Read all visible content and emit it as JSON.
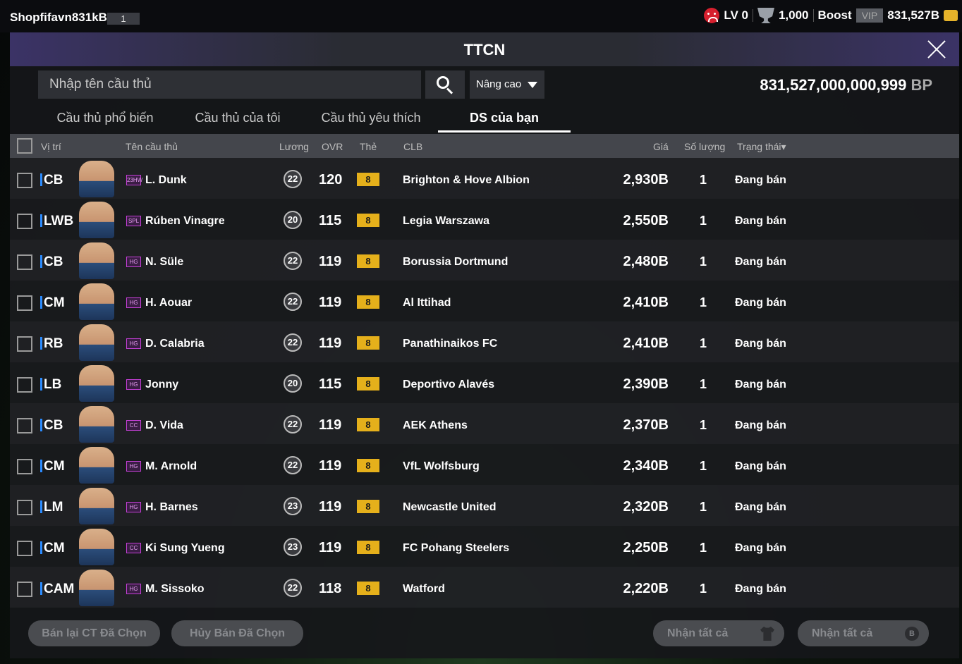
{
  "topbar": {
    "username": "Shopfifavn831kBP",
    "user_level": "1",
    "level": "LV 0",
    "cup_value": "1,000",
    "boost_label": "Boost",
    "vip_label": "VIP",
    "coins": "831,527B"
  },
  "panel": {
    "title": "TTCN",
    "search_placeholder": "Nhập tên cầu thủ",
    "advanced_label": "Nâng cao",
    "balance_value": "831,527,000,000,999",
    "balance_unit": "BP"
  },
  "tabs": [
    "Cầu thủ phổ biến",
    "Cầu thủ của tôi",
    "Cầu thủ yêu thích",
    "DS của bạn"
  ],
  "active_tab": 3,
  "columns": {
    "position": "Vị trí",
    "name": "Tên cầu thủ",
    "salary": "Lương",
    "ovr": "OVR",
    "card": "Thẻ",
    "club": "CLB",
    "price": "Giá",
    "qty": "Số lượng",
    "status": "Trạng thái▾"
  },
  "players": [
    {
      "pos": "CB",
      "season": "23HW",
      "name": "L. Dunk",
      "salary": "22",
      "ovr": "120",
      "card": "8",
      "club": "Brighton & Hove Albion",
      "price": "2,930B",
      "qty": "1",
      "status": "Đang bán"
    },
    {
      "pos": "LWB",
      "season": "SPL",
      "name": "Rúben Vinagre",
      "salary": "20",
      "ovr": "115",
      "card": "8",
      "club": "Legia Warszawa",
      "price": "2,550B",
      "qty": "1",
      "status": "Đang bán"
    },
    {
      "pos": "CB",
      "season": "HG",
      "name": "N. Süle",
      "salary": "22",
      "ovr": "119",
      "card": "8",
      "club": "Borussia Dortmund",
      "price": "2,480B",
      "qty": "1",
      "status": "Đang bán"
    },
    {
      "pos": "CM",
      "season": "HG",
      "name": "H. Aouar",
      "salary": "22",
      "ovr": "119",
      "card": "8",
      "club": "Al Ittihad",
      "price": "2,410B",
      "qty": "1",
      "status": "Đang bán"
    },
    {
      "pos": "RB",
      "season": "HG",
      "name": "D. Calabria",
      "salary": "22",
      "ovr": "119",
      "card": "8",
      "club": "Panathinaikos FC",
      "price": "2,410B",
      "qty": "1",
      "status": "Đang bán"
    },
    {
      "pos": "LB",
      "season": "HG",
      "name": "Jonny",
      "salary": "20",
      "ovr": "115",
      "card": "8",
      "club": "Deportivo Alavés",
      "price": "2,390B",
      "qty": "1",
      "status": "Đang bán"
    },
    {
      "pos": "CB",
      "season": "CC",
      "name": "D. Vida",
      "salary": "22",
      "ovr": "119",
      "card": "8",
      "club": "AEK Athens",
      "price": "2,370B",
      "qty": "1",
      "status": "Đang bán"
    },
    {
      "pos": "CM",
      "season": "HG",
      "name": "M. Arnold",
      "salary": "22",
      "ovr": "119",
      "card": "8",
      "club": "VfL Wolfsburg",
      "price": "2,340B",
      "qty": "1",
      "status": "Đang bán"
    },
    {
      "pos": "LM",
      "season": "HG",
      "name": "H. Barnes",
      "salary": "23",
      "ovr": "119",
      "card": "8",
      "club": "Newcastle United",
      "price": "2,320B",
      "qty": "1",
      "status": "Đang bán"
    },
    {
      "pos": "CM",
      "season": "CC",
      "name": "Ki Sung Yueng",
      "salary": "23",
      "ovr": "119",
      "card": "8",
      "club": "FC Pohang Steelers",
      "price": "2,250B",
      "qty": "1",
      "status": "Đang bán"
    },
    {
      "pos": "CAM",
      "season": "HG",
      "name": "M. Sissoko",
      "salary": "22",
      "ovr": "118",
      "card": "8",
      "club": "Watford",
      "price": "2,220B",
      "qty": "1",
      "status": "Đang bán"
    }
  ],
  "footer": {
    "resell_label": "Bán lại CT Đã Chọn",
    "cancel_label": "Hủy Bán Đã Chọn",
    "claim_players_label": "Nhận tất cả",
    "claim_bp_label": "Nhận tất cả",
    "bp_icon_letter": "B"
  },
  "colors": {
    "position_accent": "#2c8cff",
    "card_badge": "#e5b01b",
    "season_badge": "#c43fd6"
  }
}
